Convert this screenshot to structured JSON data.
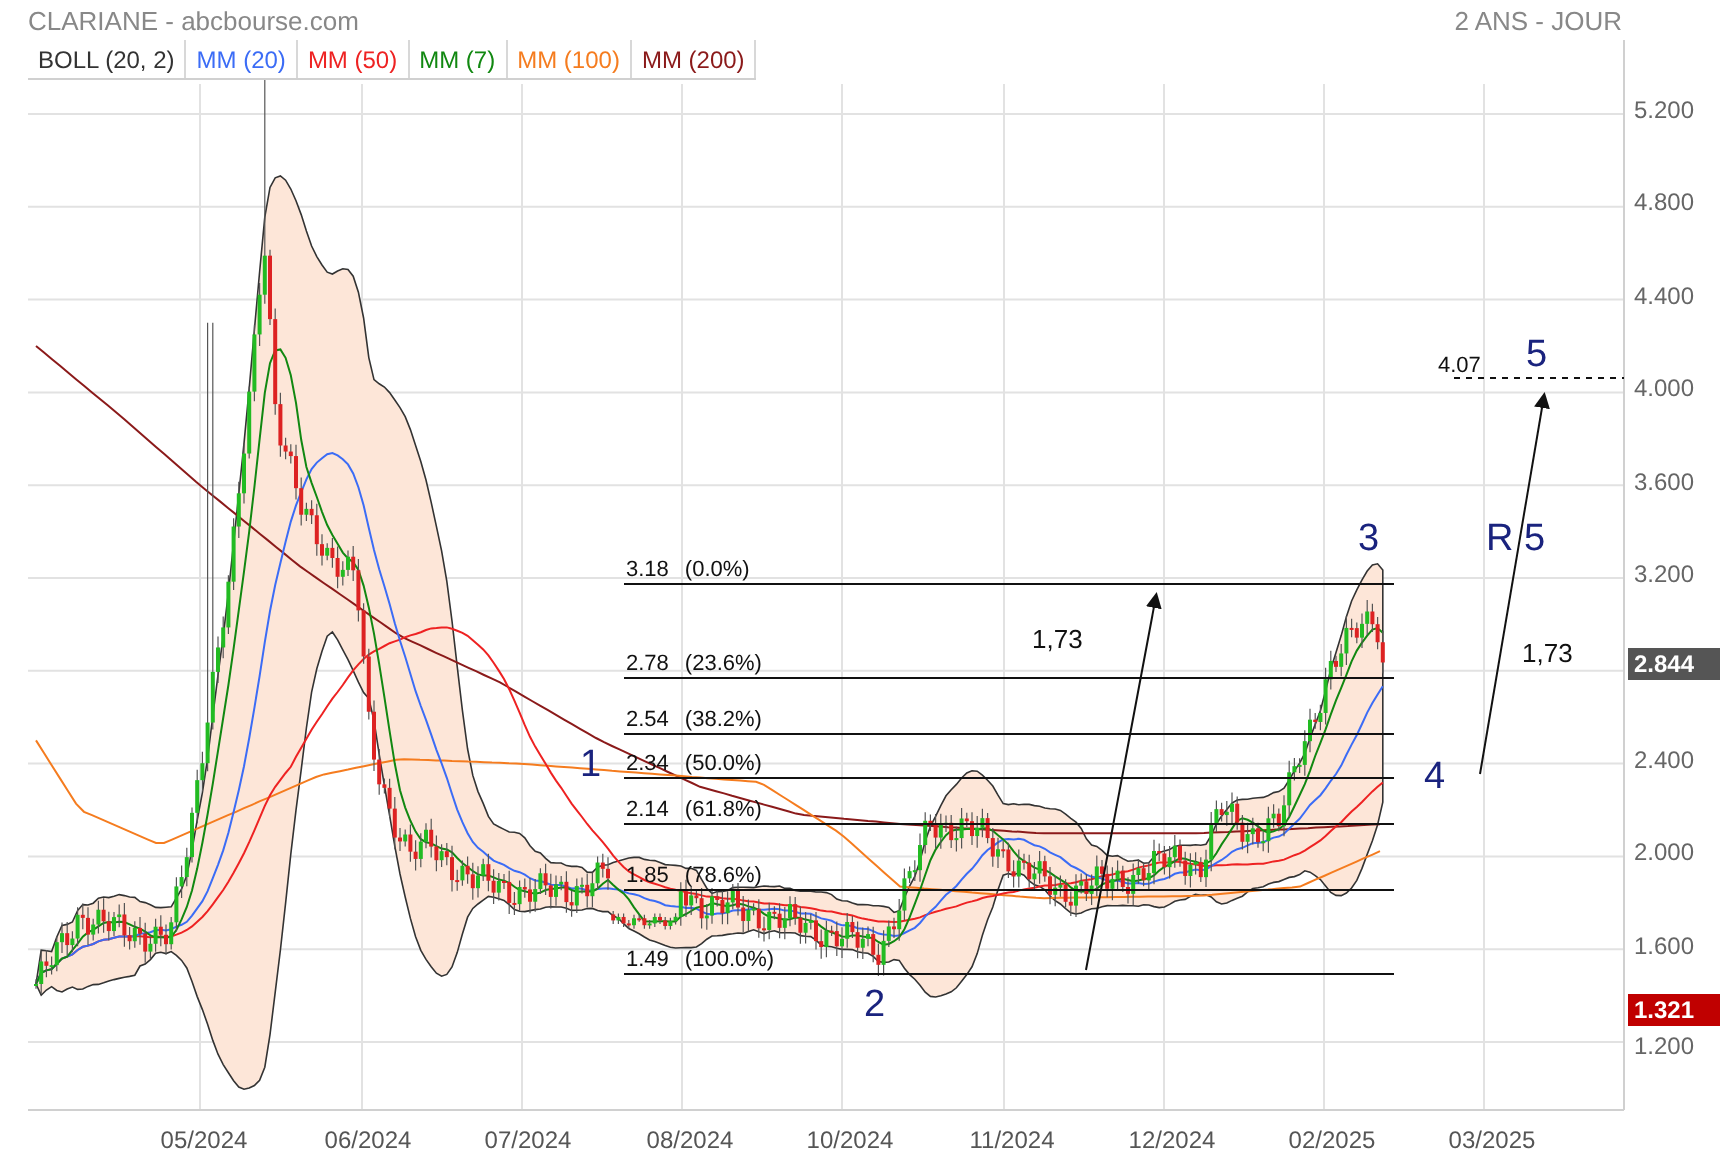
{
  "header": {
    "title": "CLARIANE - abcbourse.com",
    "period": "2 ANS - JOUR"
  },
  "legend": [
    {
      "label": "BOLL (20, 2)",
      "color": "#333333"
    },
    {
      "label": "MM (20)",
      "color": "#3b6cf6"
    },
    {
      "label": "MM (50)",
      "color": "#ee2222"
    },
    {
      "label": "MM (7)",
      "color": "#118811"
    },
    {
      "label": "MM (100)",
      "color": "#f57c1f"
    },
    {
      "label": "MM (200)",
      "color": "#8b1a1a"
    }
  ],
  "y_axis": [
    "5.200",
    "4.800",
    "4.400",
    "4.000",
    "3.600",
    "3.200",
    "2.400",
    "2.000",
    "1.600",
    "1.200"
  ],
  "x_axis": [
    "05/2024",
    "06/2024",
    "07/2024",
    "08/2024",
    "10/2024",
    "11/2024",
    "12/2024",
    "02/2025",
    "03/2025"
  ],
  "price_tags": [
    {
      "text": "2.844",
      "kind": "last"
    },
    {
      "text": "1.321",
      "kind": "low"
    }
  ],
  "fib_levels": [
    {
      "value": "3.18",
      "percent": "(0.0%)"
    },
    {
      "value": "2.78",
      "percent": "(23.6%)"
    },
    {
      "value": "2.54",
      "percent": "(38.2%)"
    },
    {
      "value": "2.34",
      "percent": "(50.0%)"
    },
    {
      "value": "2.14",
      "percent": "(61.8%)"
    },
    {
      "value": "1.85",
      "percent": "(78.6%)"
    },
    {
      "value": "1.49",
      "percent": "(100.0%)"
    }
  ],
  "wave_labels": [
    "1",
    "2",
    "3",
    "R 5",
    "4",
    "5"
  ],
  "annotations": [
    "1,73",
    "1,73",
    "4.07"
  ]
}
